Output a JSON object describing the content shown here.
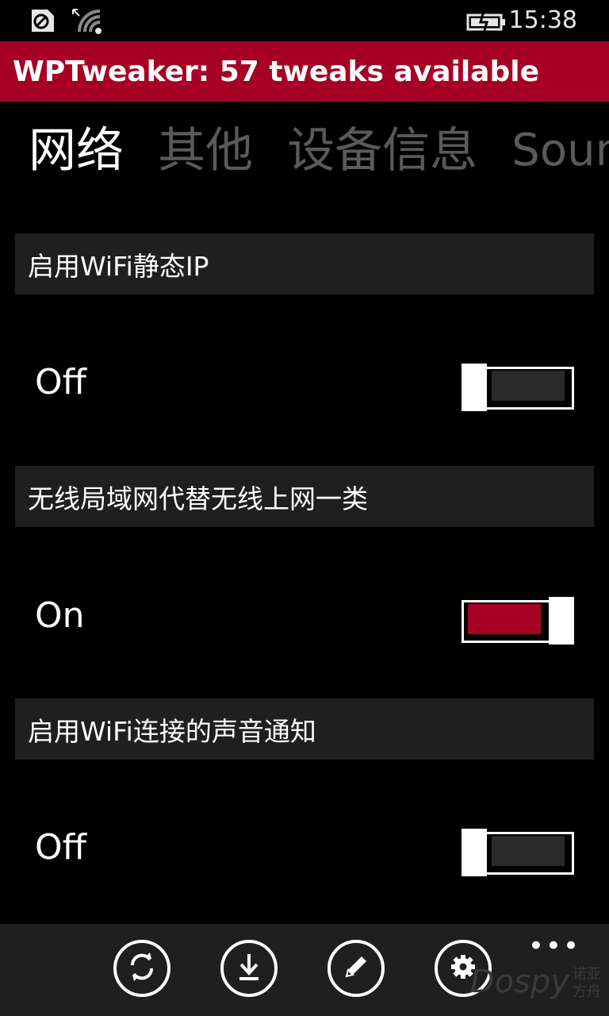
{
  "status_bar": {
    "time": "15:38"
  },
  "app": {
    "title": "WPTweaker: 57 tweaks available"
  },
  "pivot": {
    "items": [
      "网络",
      "其他",
      "设备信息",
      "Sounds"
    ],
    "active_index": 0
  },
  "settings": [
    {
      "label": "启用WiFi静态IP",
      "state": "Off",
      "on": false
    },
    {
      "label": "无线局域网代替无线上网一类",
      "state": "On",
      "on": true
    },
    {
      "label": "启用WiFi连接的声音通知",
      "state": "Off",
      "on": false
    }
  ],
  "app_bar": {
    "buttons": [
      "refresh-icon",
      "download-icon",
      "edit-icon",
      "settings-icon"
    ],
    "more_label": "•••"
  },
  "watermark": {
    "text": "Dospy",
    "cn_top": "诺亚",
    "cn_bottom": "方舟"
  },
  "colors": {
    "accent": "#a70025",
    "panel": "#1f1f1f",
    "inactive_text": "#5a5a5a"
  }
}
